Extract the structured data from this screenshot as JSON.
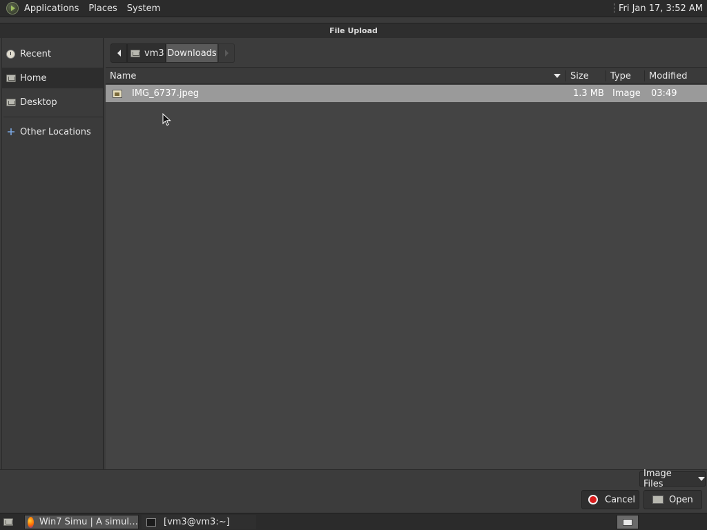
{
  "top_panel": {
    "menus": [
      "Applications",
      "Places",
      "System"
    ],
    "clock": "Fri Jan 17,  3:52 AM"
  },
  "window": {
    "title": "File Upload"
  },
  "sidebar": {
    "items": [
      {
        "label": "Recent",
        "icon": "recent-clock-icon",
        "active": false
      },
      {
        "label": "Home",
        "icon": "home-folder-icon",
        "active": true
      },
      {
        "label": "Desktop",
        "icon": "desktop-folder-icon",
        "active": false
      },
      {
        "label": "Other Locations",
        "icon": "plus-icon",
        "active": false
      }
    ]
  },
  "pathbar": {
    "segments": [
      "vm3",
      "Downloads"
    ],
    "current": "Downloads"
  },
  "file_list": {
    "columns": [
      "Name",
      "Size",
      "Type",
      "Modified"
    ],
    "rows": [
      {
        "name": "IMG_6737.jpeg",
        "size": "1.3 MB",
        "type": "Image",
        "modified": "03:49",
        "icon": "image-file-icon",
        "selected": true
      }
    ]
  },
  "footer": {
    "filter": "Image Files",
    "cancel_label": "Cancel",
    "open_label": "Open"
  },
  "taskbar": {
    "tasks": [
      {
        "label": "Win7 Simu | A simul…",
        "icon": "firefox-icon",
        "active": true
      },
      {
        "label": "[vm3@vm3:~]",
        "icon": "terminal-icon",
        "active": false
      }
    ]
  },
  "colors": {
    "selection": "#9a9a9a",
    "cancel_red": "#d81c1c"
  }
}
